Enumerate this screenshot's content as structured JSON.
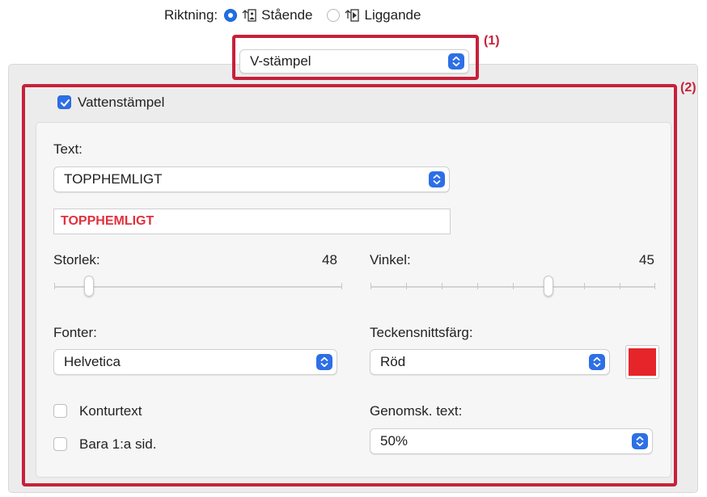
{
  "orientation": {
    "label": "Riktning:",
    "options": [
      {
        "label": "Stående",
        "selected": true
      },
      {
        "label": "Liggande",
        "selected": false
      }
    ]
  },
  "mode_select": {
    "value": "V-stämpel"
  },
  "callouts": {
    "one": "(1)",
    "two": "(2)"
  },
  "watermark": {
    "checkbox_label": "Vattenstämpel",
    "checked": true,
    "text_label": "Text:",
    "text_select_value": "TOPPHEMLIGT",
    "text_field_value": "TOPPHEMLIGT",
    "size_label": "Storlek:",
    "size_value": "48",
    "size_fraction": 0.12,
    "angle_label": "Vinkel:",
    "angle_value": "45",
    "angle_fraction": 0.625,
    "font_label": "Fonter:",
    "font_value": "Helvetica",
    "color_label": "Teckensnittsfärg:",
    "color_value": "Röd",
    "color_swatch": "#e5252a",
    "outline_label": "Konturtext",
    "outline_checked": false,
    "first_page_label": "Bara 1:a sid.",
    "first_page_checked": false,
    "transparency_label": "Genomsk. text:",
    "transparency_value": "50%"
  },
  "colors": {
    "accent": "#2d6fe6",
    "callout": "#c8203a",
    "preview_text": "#e0313e"
  },
  "icons": {
    "portrait": "portrait-page-icon",
    "landscape": "landscape-page-icon",
    "stepper": "updown-chevron-icon",
    "check": "checkmark-icon"
  }
}
